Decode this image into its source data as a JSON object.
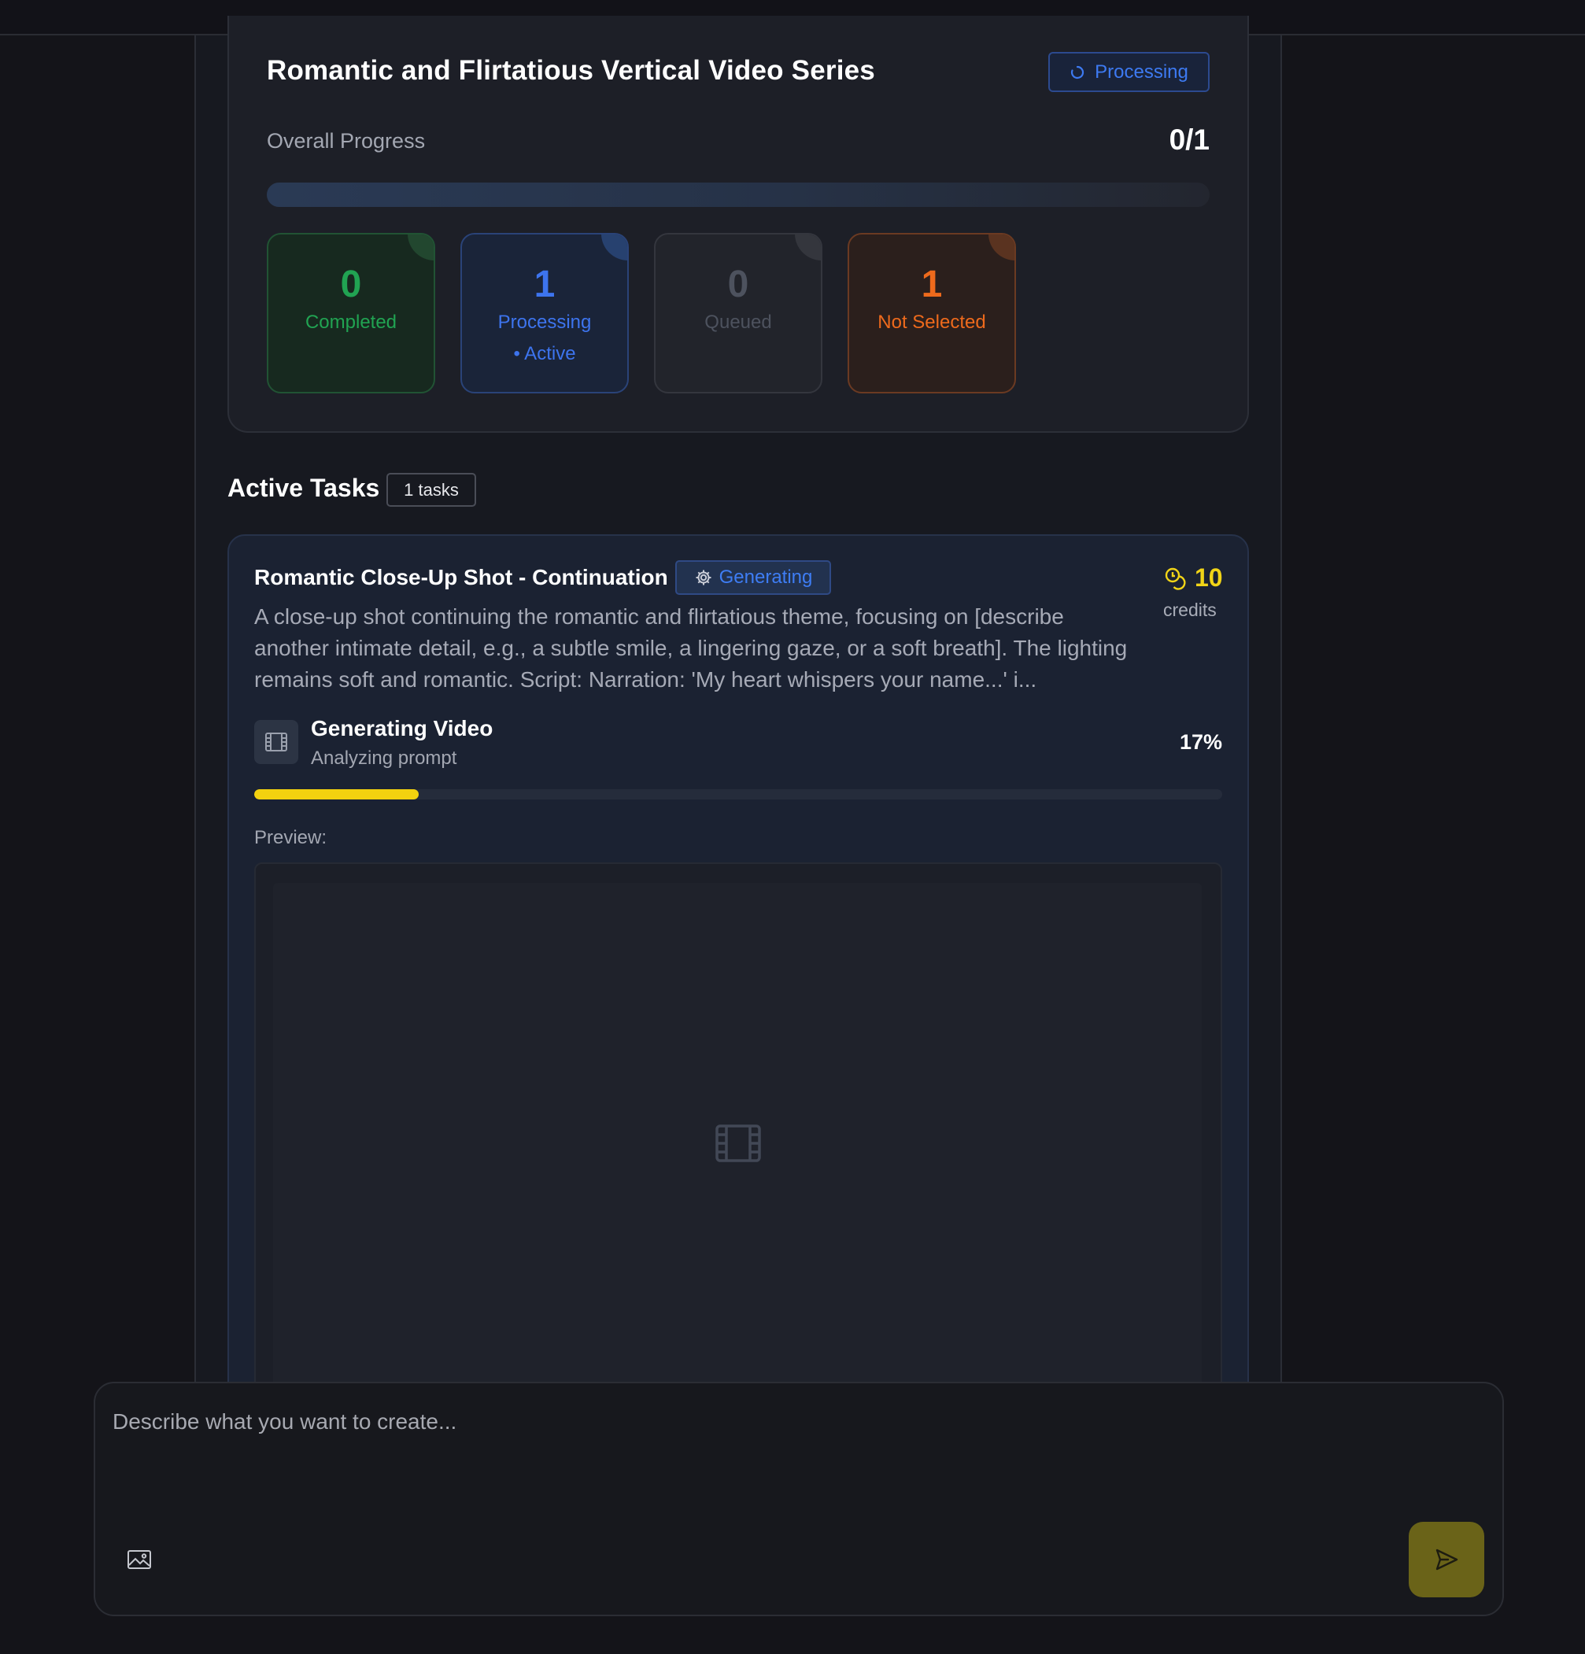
{
  "series": {
    "title": "Romantic and Flirtatious Vertical Video Series",
    "status": "Processing",
    "progress_label": "Overall Progress",
    "progress_count": "0/1",
    "progress_fraction": 0.0
  },
  "stats": {
    "completed": {
      "value": "0",
      "label": "Completed"
    },
    "processing": {
      "value": "1",
      "label": "Processing",
      "sub": "• Active"
    },
    "queued": {
      "value": "0",
      "label": "Queued"
    },
    "not_selected": {
      "value": "1",
      "label": "Not Selected"
    }
  },
  "active_tasks": {
    "heading": "Active Tasks",
    "count_badge": "1 tasks"
  },
  "task": {
    "title": "Romantic Close-Up Shot - Continuation",
    "status": "Generating",
    "credits_value": "10",
    "credits_label": "credits",
    "description": "A close-up shot continuing the romantic and flirtatious theme, focusing on [describe another intimate detail, e.g., a subtle smile, a lingering gaze, or a soft breath]. The lighting remains soft and romantic. Script: Narration: 'My heart whispers your name...' i...",
    "stage_title": "Generating Video",
    "stage_sub": "Analyzing prompt",
    "percent": "17%",
    "progress_fraction": 0.17,
    "preview_label": "Preview:"
  },
  "composer": {
    "placeholder": "Describe what you want to create...",
    "value": ""
  },
  "colors": {
    "accent_blue": "#3d7af2",
    "success_green": "#21a352",
    "warning_orange": "#ee6a1c",
    "credits_yellow": "#f1d417",
    "progress_yellow": "#f3d20f"
  },
  "icons": [
    "spinner-icon",
    "gear-icon",
    "coins-icon",
    "film-icon",
    "image-icon",
    "send-icon"
  ]
}
